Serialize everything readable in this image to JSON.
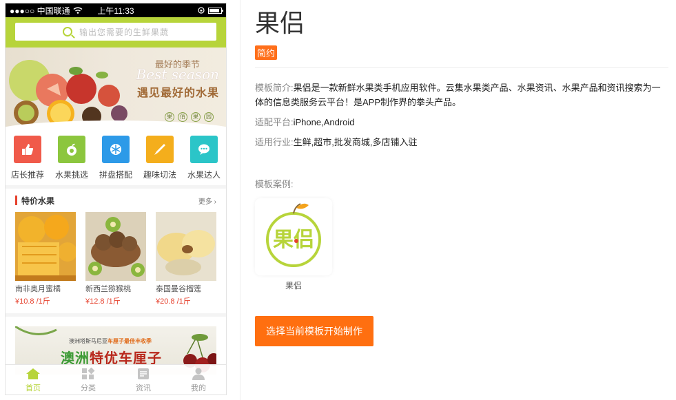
{
  "status_bar": {
    "carrier": "●●●○○ 中国联通",
    "time": "上午11:33"
  },
  "search": {
    "placeholder": "输出您需要的生鲜果蔬"
  },
  "banner": {
    "slogan_top": "最好的季节",
    "slogan_en": "Best season",
    "slogan_main": "遇见最好的水果",
    "badges": [
      "果",
      "佰",
      "果",
      "园"
    ]
  },
  "categories": [
    {
      "label": "店长推荐",
      "icon": "thumbs-up-icon",
      "color": "#f05a4a"
    },
    {
      "label": "水果挑选",
      "icon": "apple-icon",
      "color": "#8cc63e"
    },
    {
      "label": "拼盘搭配",
      "icon": "citrus-slice-icon",
      "color": "#2d9ae8"
    },
    {
      "label": "趣味切法",
      "icon": "knife-icon",
      "color": "#f4ae1c"
    },
    {
      "label": "水果达人",
      "icon": "chat-bubble-icon",
      "color": "#2bc5c8"
    }
  ],
  "special": {
    "title": "特价水果",
    "more": "更多",
    "products": [
      {
        "name": "南非奥月蜜橘",
        "price": "¥10.8 /1斤"
      },
      {
        "name": "新西兰猕猴桃",
        "price": "¥12.8 /1斤"
      },
      {
        "name": "泰国曼谷榴莲",
        "price": "¥20.8 /1斤"
      }
    ]
  },
  "promo": {
    "small_text": "澳洲塔斯马尼亚",
    "small_highlight": "车厘子最佳丰收季",
    "big_text": "澳洲",
    "big_highlight": "特优车厘子"
  },
  "tabs": [
    {
      "label": "首页",
      "icon": "home-icon",
      "active": true
    },
    {
      "label": "分类",
      "icon": "grid-icon",
      "active": false
    },
    {
      "label": "资讯",
      "icon": "document-icon",
      "active": false
    },
    {
      "label": "我的",
      "icon": "user-icon",
      "active": false
    }
  ],
  "details": {
    "title": "果侣",
    "tag": "简约",
    "intro_label": "模板简介:",
    "intro": "果侣是一款新鲜水果类手机应用软件。云集水果类产品、水果资讯、水果产品和资讯搜索为一体的信息类服务云平台！是APP制作界的拳头产品。",
    "platform_label": "适配平台:",
    "platform": "iPhone,Android",
    "industry_label": "适用行业:",
    "industry": "生鲜,超市,批发商城,多店铺入驻",
    "case_label": "模板案例:",
    "case_logo_text": "果侣",
    "case_name": "果侣",
    "cta": "选择当前模板开始制作"
  },
  "colors": {
    "accent_green": "#b7d43a",
    "accent_orange": "#ff6f10",
    "price_red": "#e6412d"
  }
}
